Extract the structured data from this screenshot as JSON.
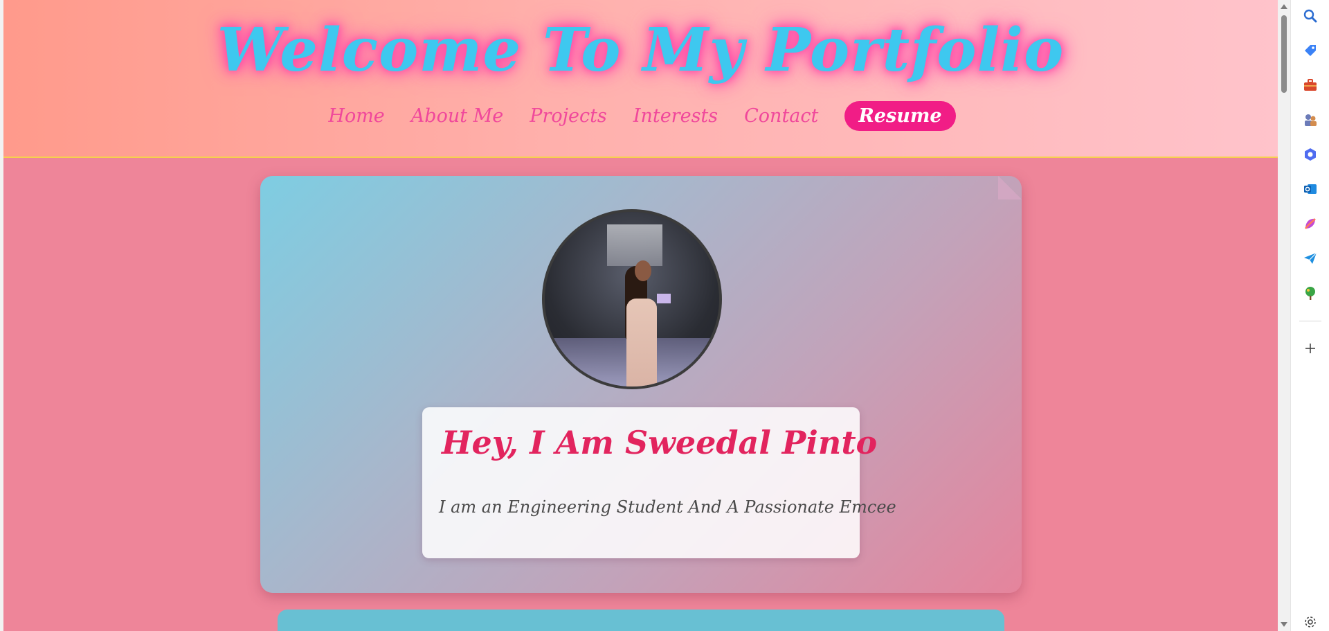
{
  "header": {
    "title": "Welcome To My Portfolio",
    "nav": [
      {
        "label": "Home"
      },
      {
        "label": "About Me"
      },
      {
        "label": "Projects"
      },
      {
        "label": "Interests"
      },
      {
        "label": "Contact"
      }
    ],
    "resume_label": "Resume"
  },
  "hero": {
    "heading": "Hey, I Am Sweedal Pinto",
    "subtext": "I am an Engineering Student And A Passionate Emcee",
    "avatar_alt": "Sweedal Pinto speaking on stage"
  },
  "sidebar": {
    "icons": [
      "search-icon",
      "tag-icon",
      "briefcase-icon",
      "chess-icon",
      "copilot-icon",
      "outlook-icon",
      "designer-icon",
      "send-icon",
      "tree-icon",
      "plus-icon",
      "settings-icon"
    ]
  },
  "colors": {
    "page_bg": "#ee8599",
    "title": "#3ec8ef",
    "title_glow": "#ff4fa9",
    "nav": "#f0489b",
    "resume_bg": "#f11d86",
    "heading": "#e2245e"
  }
}
